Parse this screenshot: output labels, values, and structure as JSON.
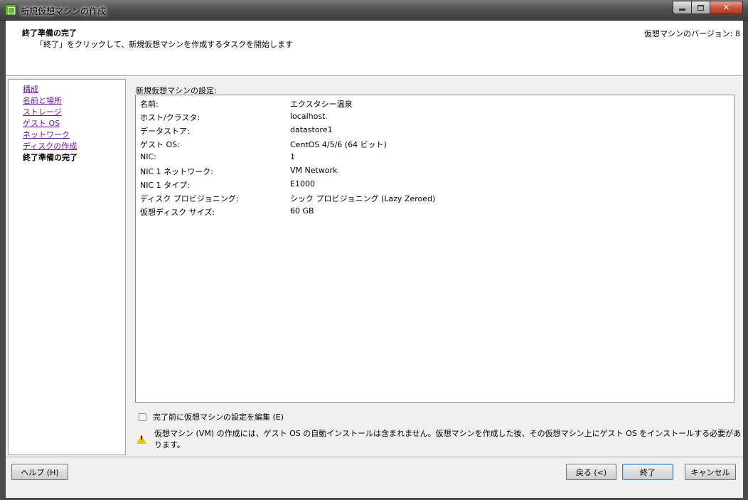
{
  "window": {
    "title": "新規仮想マシンの作成",
    "close_glyph": "✕"
  },
  "header": {
    "title": "終了準備の完了",
    "subtitle": "「終了」をクリックして、新規仮想マシンを作成するタスクを開始します",
    "version": "仮想マシンのバージョン: 8"
  },
  "nav": {
    "items": [
      {
        "label": "構成",
        "current": false
      },
      {
        "label": "名前と場所",
        "current": false
      },
      {
        "label": "ストレージ",
        "current": false
      },
      {
        "label": "ゲスト OS",
        "current": false
      },
      {
        "label": "ネットワーク",
        "current": false
      },
      {
        "label": "ディスクの作成",
        "current": false
      },
      {
        "label": "終了準備の完了",
        "current": true
      }
    ]
  },
  "settings": {
    "label": "新規仮想マシンの設定:",
    "rows": [
      {
        "key": "名前:",
        "value": "エクスタシー温泉"
      },
      {
        "key": "ホスト/クラスタ:",
        "value": "localhost."
      },
      {
        "key": "データストア:",
        "value": "datastore1"
      },
      {
        "key": "ゲスト OS:",
        "value": "CentOS 4/5/6 (64 ビット)"
      },
      {
        "key": "NIC:",
        "value": "1"
      },
      {
        "key": "NIC 1 ネットワーク:",
        "value": "VM Network"
      },
      {
        "key": "NIC 1 タイプ:",
        "value": "E1000"
      },
      {
        "key": "ディスク プロビジョニング:",
        "value": "シック プロビジョニング (Lazy Zeroed)"
      },
      {
        "key": "仮想ディスク サイズ:",
        "value": "60 GB"
      }
    ]
  },
  "options": {
    "edit_before_finish": "完了前に仮想マシンの設定を編集 (E)",
    "edit_checked": false,
    "warning": "仮想マシン (VM) の作成には、ゲスト OS の自動インストールは含まれません。仮想マシンを作成した後、その仮想マシン上にゲスト OS をインストールする必要があります。"
  },
  "footer": {
    "help": "ヘルプ (H)",
    "back": "戻る (<)",
    "finish": "終了",
    "cancel": "キャンセル"
  }
}
